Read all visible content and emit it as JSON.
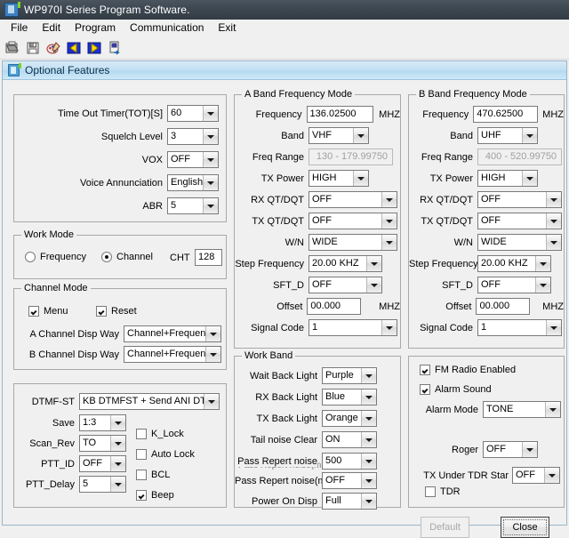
{
  "window": {
    "title": "WP970I Series Program Software.",
    "icon": "radio-app-icon"
  },
  "menubar": {
    "items": [
      {
        "label": "File"
      },
      {
        "label": "Edit"
      },
      {
        "label": "Program"
      },
      {
        "label": "Communication"
      },
      {
        "label": "Exit"
      }
    ]
  },
  "toolbar": {
    "buttons": [
      {
        "name": "open-file",
        "icon": "folder-open-icon"
      },
      {
        "name": "save-file",
        "icon": "floppy-disk-icon"
      },
      {
        "name": "edit-settings",
        "icon": "pencil-palette-icon"
      },
      {
        "name": "read-from-radio",
        "icon": "read-arrow-left-icon"
      },
      {
        "name": "write-to-radio",
        "icon": "write-arrow-right-icon"
      },
      {
        "name": "exit-app",
        "icon": "exit-door-icon"
      }
    ]
  },
  "panel": {
    "title": "Optional Features",
    "icon": "radio-panel-icon"
  },
  "general": {
    "rows": [
      {
        "label": "Time Out Timer(TOT)[S]",
        "value": "60"
      },
      {
        "label": "Squelch Level",
        "value": "3"
      },
      {
        "label": "VOX",
        "value": "OFF"
      },
      {
        "label": "Voice Annunciation",
        "value": "English"
      },
      {
        "label": "ABR",
        "value": "5"
      }
    ]
  },
  "work_mode": {
    "legend": "Work Mode",
    "radio_frequency": {
      "label": "Frequency",
      "checked": false
    },
    "radio_channel": {
      "label": "Channel",
      "checked": true
    },
    "cht_label": "CHT",
    "cht_value": "128"
  },
  "channel_mode": {
    "legend": "Channel Mode",
    "menu": {
      "label": "Menu",
      "checked": true
    },
    "reset": {
      "label": "Reset",
      "checked": true
    },
    "a_disp": {
      "label": "A Channel Disp Way",
      "value": "Channel+Frequency"
    },
    "b_disp": {
      "label": "B Channel Disp Way",
      "value": "Channel+Frequency"
    }
  },
  "dtmf": {
    "dtmf_st": {
      "label": "DTMF-ST",
      "value": "KB DTMFST + Send ANI DTM"
    },
    "save": {
      "label": "Save",
      "value": "1:3"
    },
    "scan_rev": {
      "label": "Scan_Rev",
      "value": "TO"
    },
    "ptt_id": {
      "label": "PTT_ID",
      "value": "OFF"
    },
    "ptt_delay": {
      "label": "PTT_Delay",
      "value": "5"
    },
    "k_lock": {
      "label": "K_Lock",
      "checked": false
    },
    "auto_lock": {
      "label": "Auto Lock",
      "checked": false
    },
    "bcl": {
      "label": "BCL",
      "checked": false
    },
    "beep": {
      "label": "Beep",
      "checked": true
    }
  },
  "a_band": {
    "legend": "A Band Frequency Mode",
    "frequency": {
      "label": "Frequency",
      "value": "136.02500",
      "unit": "MHZ"
    },
    "band": {
      "label": "Band",
      "value": "VHF"
    },
    "freq_range": {
      "label": "Freq Range",
      "value": "130 - 179.99750"
    },
    "tx_power": {
      "label": "TX Power",
      "value": "HIGH"
    },
    "rx_qt": {
      "label": "RX QT/DQT",
      "value": "OFF"
    },
    "tx_qt": {
      "label": "TX QT/DQT",
      "value": "OFF"
    },
    "wn": {
      "label": "W/N",
      "value": "WIDE"
    },
    "step": {
      "label": "Step Frequency",
      "value": "20.00 KHZ"
    },
    "sft_d": {
      "label": "SFT_D",
      "value": "OFF"
    },
    "offset": {
      "label": "Offset",
      "value": "00.000",
      "unit": "MHZ"
    },
    "signal_code": {
      "label": "Signal Code",
      "value": "1"
    }
  },
  "b_band": {
    "legend": "B Band Frequency Mode",
    "frequency": {
      "label": "Frequency",
      "value": "470.62500",
      "unit": "MHZ"
    },
    "band": {
      "label": "Band",
      "value": "UHF"
    },
    "freq_range": {
      "label": "Freq Range",
      "value": "400 - 520.99750"
    },
    "tx_power": {
      "label": "TX Power",
      "value": "HIGH"
    },
    "rx_qt": {
      "label": "RX QT/DQT",
      "value": "OFF"
    },
    "tx_qt": {
      "label": "TX QT/DQT",
      "value": "OFF"
    },
    "wn": {
      "label": "W/N",
      "value": "WIDE"
    },
    "step": {
      "label": "Step Frequency",
      "value": "20.00 KHZ"
    },
    "sft_d": {
      "label": "SFT_D",
      "value": "OFF"
    },
    "offset": {
      "label": "Offset",
      "value": "00.000",
      "unit": "MHZ"
    },
    "signal_code": {
      "label": "Signal Code",
      "value": "1"
    }
  },
  "work_band": {
    "legend": "Work Band",
    "wait_back_light": {
      "label": "Wait Back Light",
      "value": "Purple"
    },
    "rx_back_light": {
      "label": "RX Back Light",
      "value": "Blue"
    },
    "tx_back_light": {
      "label": "TX Back Light",
      "value": "Orange"
    },
    "tail_noise_clear": {
      "label": "Tail noise Clear",
      "value": "ON"
    },
    "pass_repert_noise": {
      "label": "Pass Repert noise",
      "value": "500"
    },
    "pass_repert_noise_hidden": {
      "label": "Pass Repert noise(ms)"
    },
    "pass_repert_noise_ms": {
      "label": "Pass Repert noise(ms)",
      "value": "OFF"
    },
    "power_on_disp": {
      "label": "Power On Disp",
      "value": "Full"
    }
  },
  "misc": {
    "fm_radio": {
      "label": "FM Radio Enabled",
      "checked": true
    },
    "alarm_sound": {
      "label": "Alarm Sound",
      "checked": true
    },
    "alarm_mode": {
      "label": "Alarm Mode",
      "value": "TONE"
    },
    "roger": {
      "label": "Roger",
      "value": "OFF"
    },
    "tx_under_tdr": {
      "label": "TX Under TDR Star",
      "value": "OFF"
    },
    "tdr": {
      "label": "TDR",
      "checked": false
    }
  },
  "footer": {
    "default_button": "Default",
    "close_button": "Close"
  }
}
